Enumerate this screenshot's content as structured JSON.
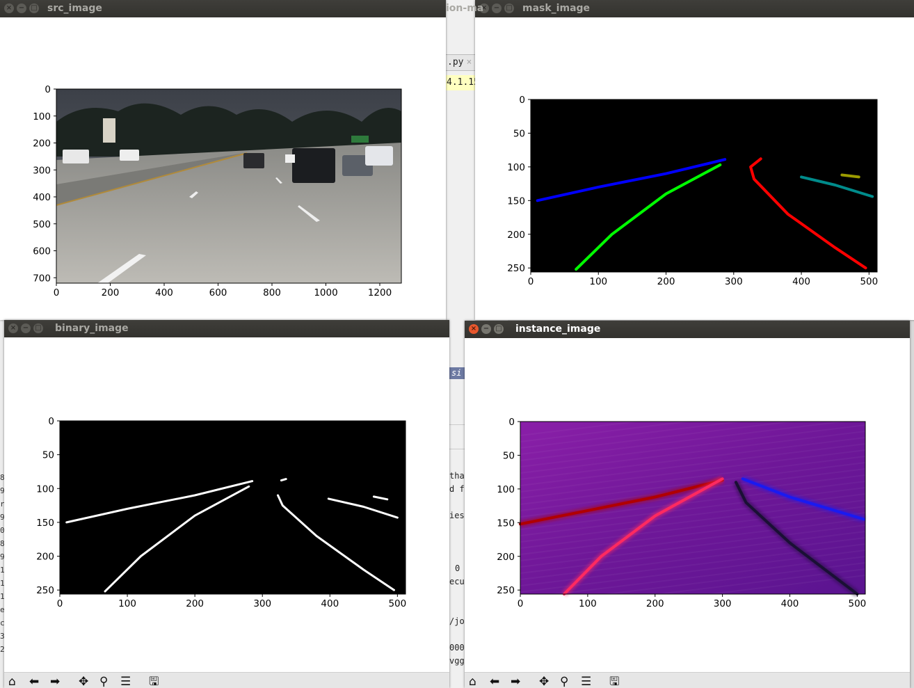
{
  "background": {
    "editor_tab": ".py",
    "editor_tab_close": "×",
    "editor_highlight": "4.1.15",
    "editor_fragment_top": "ion-ma",
    "editor_selection": "si",
    "editor_lines": [
      "tha",
      "d f",
      "ies",
      "0",
      "ecu",
      "/jo",
      "000",
      "vgg"
    ],
    "terminal_chars": [
      "8",
      "9",
      "r",
      "9",
      "0",
      "8",
      "9",
      "1",
      "1",
      "1",
      "e",
      "c",
      "3",
      "2"
    ]
  },
  "windows": {
    "src": {
      "title": "src_image"
    },
    "mask": {
      "title": "mask_image"
    },
    "binary": {
      "title": "binary_image"
    },
    "instance": {
      "title": "instance_image"
    }
  },
  "window_buttons": {
    "close": "×",
    "minimize": "−",
    "maximize": "□"
  },
  "toolbar_icons": [
    "home-icon",
    "back-arrow-icon",
    "forward-arrow-icon",
    "pan-icon",
    "zoom-icon",
    "configure-subplots-icon",
    "save-icon"
  ],
  "toolbar_glyphs": [
    "⌂",
    "⬅",
    "➡",
    "✥",
    "⚲",
    "☰",
    "🖫"
  ],
  "colors": {
    "titlebar": "#3c3b37",
    "close_active": "#e8572d",
    "lane_blue": "#0000ff",
    "lane_green": "#00ff00",
    "lane_red": "#ff0000",
    "lane_teal": "#008b8b",
    "lane_olive": "#9b9b00",
    "instance_bg": "#7a1aa0"
  },
  "chart_data": [
    {
      "id": "src_image",
      "type": "image",
      "x_ticks": [
        "0",
        "200",
        "400",
        "600",
        "800",
        "1000",
        "1200"
      ],
      "y_ticks": [
        "0",
        "100",
        "200",
        "300",
        "400",
        "500",
        "600",
        "700"
      ],
      "xlim": [
        0,
        1280
      ],
      "ylim": [
        720,
        0
      ]
    },
    {
      "id": "mask_image",
      "type": "image",
      "x_ticks": [
        "0",
        "100",
        "200",
        "300",
        "400",
        "500"
      ],
      "y_ticks": [
        "0",
        "50",
        "100",
        "150",
        "200",
        "250"
      ],
      "xlim": [
        0,
        512
      ],
      "ylim": [
        256,
        0
      ],
      "series": [
        {
          "color": "#0000ff",
          "points": [
            [
              10,
              150
            ],
            [
              100,
              130
            ],
            [
              200,
              110
            ],
            [
              287,
              89
            ]
          ]
        },
        {
          "color": "#00ff00",
          "points": [
            [
              67,
              252
            ],
            [
              120,
              200
            ],
            [
              200,
              140
            ],
            [
              280,
              97
            ]
          ]
        },
        {
          "color": "#ff0000",
          "points": [
            [
              340,
              88
            ],
            [
              325,
              100
            ],
            [
              330,
              118
            ],
            [
              380,
              170
            ],
            [
              450,
              220
            ],
            [
              495,
              250
            ]
          ]
        },
        {
          "color": "#008b8b",
          "points": [
            [
              400,
              115
            ],
            [
              450,
              127
            ],
            [
              505,
              144
            ]
          ]
        },
        {
          "color": "#9b9b00",
          "points": [
            [
              460,
              112
            ],
            [
              485,
              115
            ]
          ]
        }
      ]
    },
    {
      "id": "binary_image",
      "type": "image",
      "x_ticks": [
        "0",
        "100",
        "200",
        "300",
        "400",
        "500"
      ],
      "y_ticks": [
        "0",
        "50",
        "100",
        "150",
        "200",
        "250"
      ],
      "xlim": [
        0,
        512
      ],
      "ylim": [
        256,
        0
      ],
      "series": [
        {
          "points": [
            [
              10,
              150
            ],
            [
              100,
              130
            ],
            [
              200,
              110
            ],
            [
              285,
              89
            ]
          ]
        },
        {
          "points": [
            [
              67,
              252
            ],
            [
              120,
              200
            ],
            [
              200,
              140
            ],
            [
              280,
              97
            ]
          ]
        },
        {
          "points": [
            [
              328,
              88
            ],
            [
              335,
              86
            ]
          ]
        },
        {
          "points": [
            [
              323,
              110
            ],
            [
              330,
              125
            ],
            [
              380,
              170
            ],
            [
              450,
              220
            ],
            [
              495,
              250
            ]
          ]
        },
        {
          "points": [
            [
              398,
              115
            ],
            [
              450,
              127
            ],
            [
              500,
              143
            ]
          ]
        },
        {
          "points": [
            [
              465,
              112
            ],
            [
              485,
              116
            ]
          ]
        }
      ]
    },
    {
      "id": "instance_image",
      "type": "heatmap",
      "x_ticks": [
        "0",
        "100",
        "200",
        "300",
        "400",
        "500"
      ],
      "y_ticks": [
        "0",
        "50",
        "100",
        "150",
        "200",
        "250"
      ],
      "xlim": [
        0,
        512
      ],
      "ylim": [
        256,
        0
      ],
      "series": [
        {
          "color": "#b00000",
          "points": [
            [
              0,
              152
            ],
            [
              100,
              132
            ],
            [
              200,
              112
            ],
            [
              300,
              87
            ]
          ]
        },
        {
          "color": "#ff2a60",
          "points": [
            [
              65,
              256
            ],
            [
              120,
              200
            ],
            [
              200,
              140
            ],
            [
              300,
              85
            ]
          ]
        },
        {
          "color": "#1a1035",
          "points": [
            [
              320,
              90
            ],
            [
              335,
              120
            ],
            [
              400,
              180
            ],
            [
              500,
              256
            ]
          ]
        },
        {
          "color": "#1a1af0",
          "points": [
            [
              330,
              85
            ],
            [
              400,
              112
            ],
            [
              510,
              145
            ]
          ]
        }
      ]
    }
  ]
}
